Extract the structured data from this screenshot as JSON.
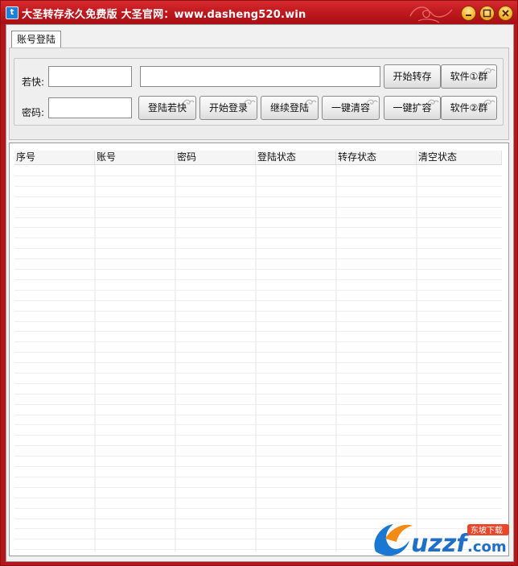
{
  "window": {
    "title": "大圣转存永久免费版  大圣官网：www.dasheng520.win",
    "accent": "#b5161b"
  },
  "tabs": [
    {
      "label": "账号登陆",
      "active": true
    }
  ],
  "form": {
    "ruokuai_label": "若快:",
    "password_label": "密码:",
    "ruokuai_value": "",
    "password_value": "",
    "long_input_value": ""
  },
  "buttons": {
    "start_transfer": "开始转存",
    "software_group_1": "软件①群",
    "login_ruokuai": "登陆若快",
    "start_login": "开始登录",
    "continue_login": "继续登陆",
    "one_click_clear": "一键清容",
    "one_click_expand": "一键扩容",
    "software_group_2": "软件②群"
  },
  "table": {
    "columns": [
      "序号",
      "账号",
      "密码",
      "登陆状态",
      "转存状态",
      "清空状态"
    ],
    "rows": []
  },
  "watermark": {
    "text": "uzzf.com",
    "badge": "东坡下载"
  },
  "icons": [
    "app-icon",
    "minimize-icon",
    "maximize-icon",
    "close-icon"
  ]
}
